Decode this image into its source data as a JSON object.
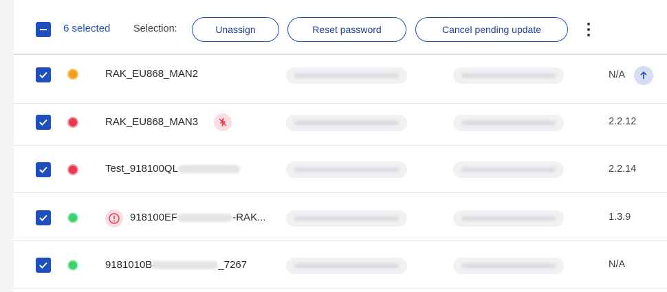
{
  "toolbar": {
    "selected_count": "6 selected",
    "selection_label": "Selection:",
    "unassign_label": "Unassign",
    "reset_password_label": "Reset password",
    "cancel_update_label": "Cancel pending update",
    "more_icon": "kebab-vertical-icon"
  },
  "colors": {
    "accent": "#1f4fbf",
    "status_orange": "#f0a11a",
    "status_red": "#e8394f",
    "status_green": "#3ecf6e"
  },
  "rows": [
    {
      "name_prefix": "RAK_EU868_MAN2",
      "name_suffix": "",
      "status": "orange",
      "firmware": "N/A",
      "checked": true,
      "update_icon": "arrow-up-icon"
    },
    {
      "name_prefix": "RAK_EU868_MAN3",
      "name_suffix": "",
      "status": "red",
      "firmware": "2.2.12",
      "checked": true,
      "badge_icon": "connection-off-icon"
    },
    {
      "name_prefix": "Test_918100QL",
      "name_suffix": "",
      "status": "red",
      "firmware": "2.2.14",
      "checked": true
    },
    {
      "name_prefix": "918100EF",
      "name_suffix": "-RAK...",
      "status": "green",
      "firmware": "1.3.9",
      "checked": true,
      "warning_icon": "alert-circle-icon"
    },
    {
      "name_prefix": "9181010B",
      "name_suffix": "_7267",
      "status": "green",
      "firmware": "N/A",
      "checked": true
    }
  ]
}
